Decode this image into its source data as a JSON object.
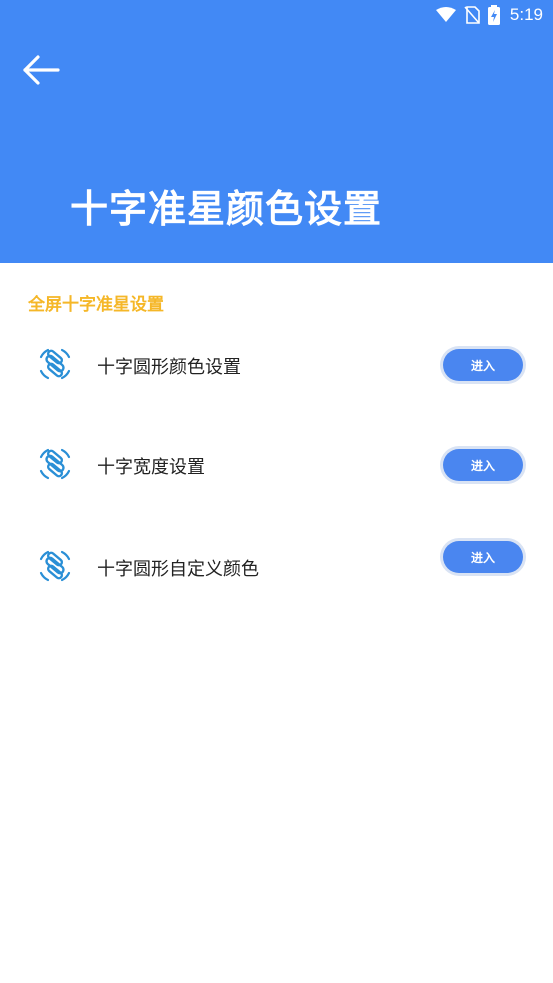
{
  "status_bar": {
    "time": "5:19",
    "icons": [
      "wifi-icon",
      "no-sim-icon",
      "battery-charging-icon"
    ]
  },
  "header": {
    "back_icon": "arrow-left-icon",
    "title": "十字准星颜色设置",
    "background_color": "#4289f5"
  },
  "section": {
    "title": "全屏十字准星设置",
    "title_color": "#f5b728"
  },
  "items": [
    {
      "icon": "crosshair-setting-icon",
      "label": "十字圆形颜色设置",
      "button_label": "进入"
    },
    {
      "icon": "crosshair-setting-icon",
      "label": "十字宽度设置",
      "button_label": "进入"
    },
    {
      "icon": "crosshair-setting-icon",
      "label": "十字圆形自定义颜色",
      "button_label": "进入"
    }
  ],
  "colors": {
    "accent": "#4a86f0",
    "icon": "#2a8fd6"
  }
}
